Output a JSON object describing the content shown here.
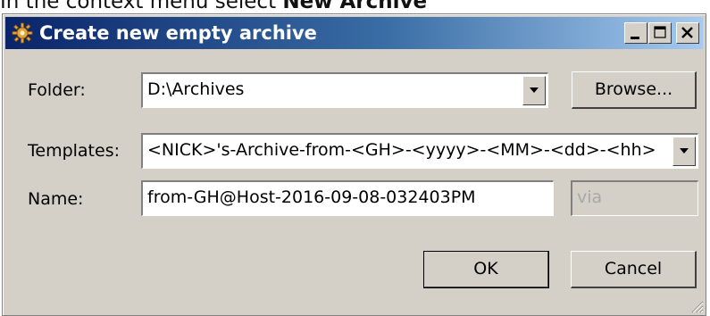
{
  "caption": {
    "prefix": "In the context menu select ",
    "emphasis": "New Archive"
  },
  "window": {
    "title": "Create new empty archive",
    "controls": {
      "minimize": "minimize",
      "maximize": "maximize",
      "close": "close"
    }
  },
  "form": {
    "folder": {
      "label": "Folder:",
      "value": "D:\\Archives",
      "browse_label": "Browse..."
    },
    "templates": {
      "label": "Templates:",
      "value": "<NICK>'s-Archive-from-<GH>-<yyyy>-<MM>-<dd>-<hh>"
    },
    "name": {
      "label": "Name:",
      "value": "from-GH@Host-2016-09-08-032403PM",
      "via_placeholder": "via"
    }
  },
  "buttons": {
    "ok": "OK",
    "cancel": "Cancel"
  },
  "colors": {
    "title_gradient_start": "#0a246a",
    "title_gradient_end": "#a6caf0",
    "dialog_face": "#d4d0c8"
  }
}
